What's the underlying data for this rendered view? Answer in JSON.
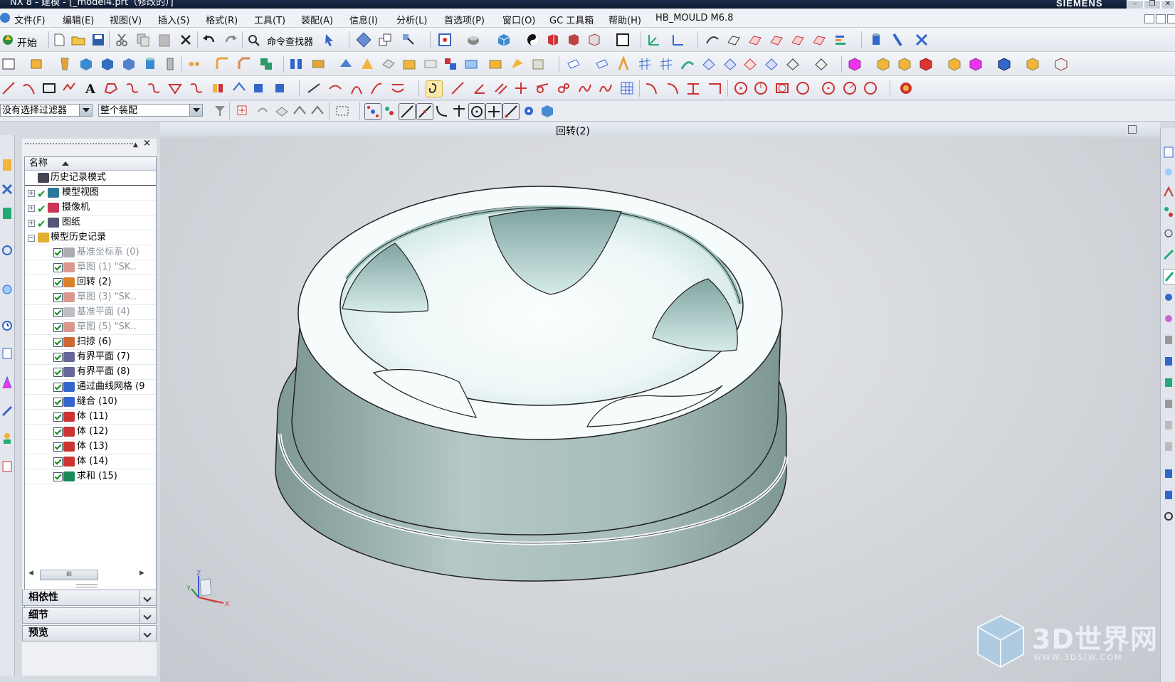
{
  "window": {
    "title": "NX 8 - 建模 - [_model4.prt（修改的）]",
    "brand": "SIEMENS"
  },
  "menu": [
    "文件(F)",
    "编辑(E)",
    "视图(V)",
    "插入(S)",
    "格式(R)",
    "工具(T)",
    "装配(A)",
    "信息(I)",
    "分析(L)",
    "首选项(P)",
    "窗口(O)",
    "GC 工具箱",
    "帮助(H)",
    "HB_MOULD M6.8"
  ],
  "toolbar": {
    "start_label": "开始",
    "command_finder_label": "命令查找器"
  },
  "filter": {
    "selection_filter": "没有选择过滤器",
    "assembly_scope": "整个装配"
  },
  "graphics_header": {
    "feature_name": "回转(2)"
  },
  "navigator": {
    "column_name": "名称",
    "rows": [
      {
        "label": "历史记录模式",
        "icon": "history-clock-icon"
      },
      {
        "label": "模型视图",
        "icon": "model-views-icon"
      },
      {
        "label": "摄像机",
        "icon": "camera-icon"
      },
      {
        "label": "图纸",
        "icon": "drawing-sheet-icon"
      },
      {
        "label": "模型历史记录",
        "icon": "folder-icon"
      },
      {
        "label": "基准坐标系 (0)",
        "icon": "datum-csys-icon",
        "suppressed": true
      },
      {
        "label": "草图 (1) \"SK..",
        "icon": "sketch-icon",
        "suppressed": true
      },
      {
        "label": "回转 (2)",
        "icon": "revolve-icon",
        "suppressed": false
      },
      {
        "label": "草图 (3) \"SK..",
        "icon": "sketch-icon",
        "suppressed": true
      },
      {
        "label": "基准平面 (4)",
        "icon": "datum-plane-icon",
        "suppressed": true
      },
      {
        "label": "草图 (5) \"SK..",
        "icon": "sketch-icon",
        "suppressed": true
      },
      {
        "label": "扫掠 (6)",
        "icon": "swept-icon",
        "suppressed": false
      },
      {
        "label": "有界平面 (7)",
        "icon": "bounded-plane-icon",
        "suppressed": false
      },
      {
        "label": "有界平面 (8)",
        "icon": "bounded-plane-icon",
        "suppressed": false
      },
      {
        "label": "通过曲线网格 (9",
        "icon": "through-curve-mesh-icon",
        "suppressed": false
      },
      {
        "label": "缝合 (10)",
        "icon": "sew-icon",
        "suppressed": false
      },
      {
        "label": "体 (11)",
        "icon": "body-icon",
        "suppressed": false
      },
      {
        "label": "体 (12)",
        "icon": "body-icon",
        "suppressed": false
      },
      {
        "label": "体 (13)",
        "icon": "body-icon",
        "suppressed": false
      },
      {
        "label": "体 (14)",
        "icon": "body-icon",
        "suppressed": false
      },
      {
        "label": "求和 (15)",
        "icon": "unite-icon",
        "suppressed": false
      }
    ],
    "sections": [
      "相依性",
      "细节",
      "预览"
    ]
  },
  "triad": {
    "x_label": "X",
    "y_label": "Y",
    "z_label": "Z"
  },
  "watermark": {
    "text": "3D世界网",
    "sub": "WWW.3DSJW.COM"
  },
  "colors": {
    "viewport_bg": "#d3d6db",
    "part_side": "#9fb5b1",
    "part_top": "#f6fbfb",
    "part_cavity": "#d7eceb"
  }
}
